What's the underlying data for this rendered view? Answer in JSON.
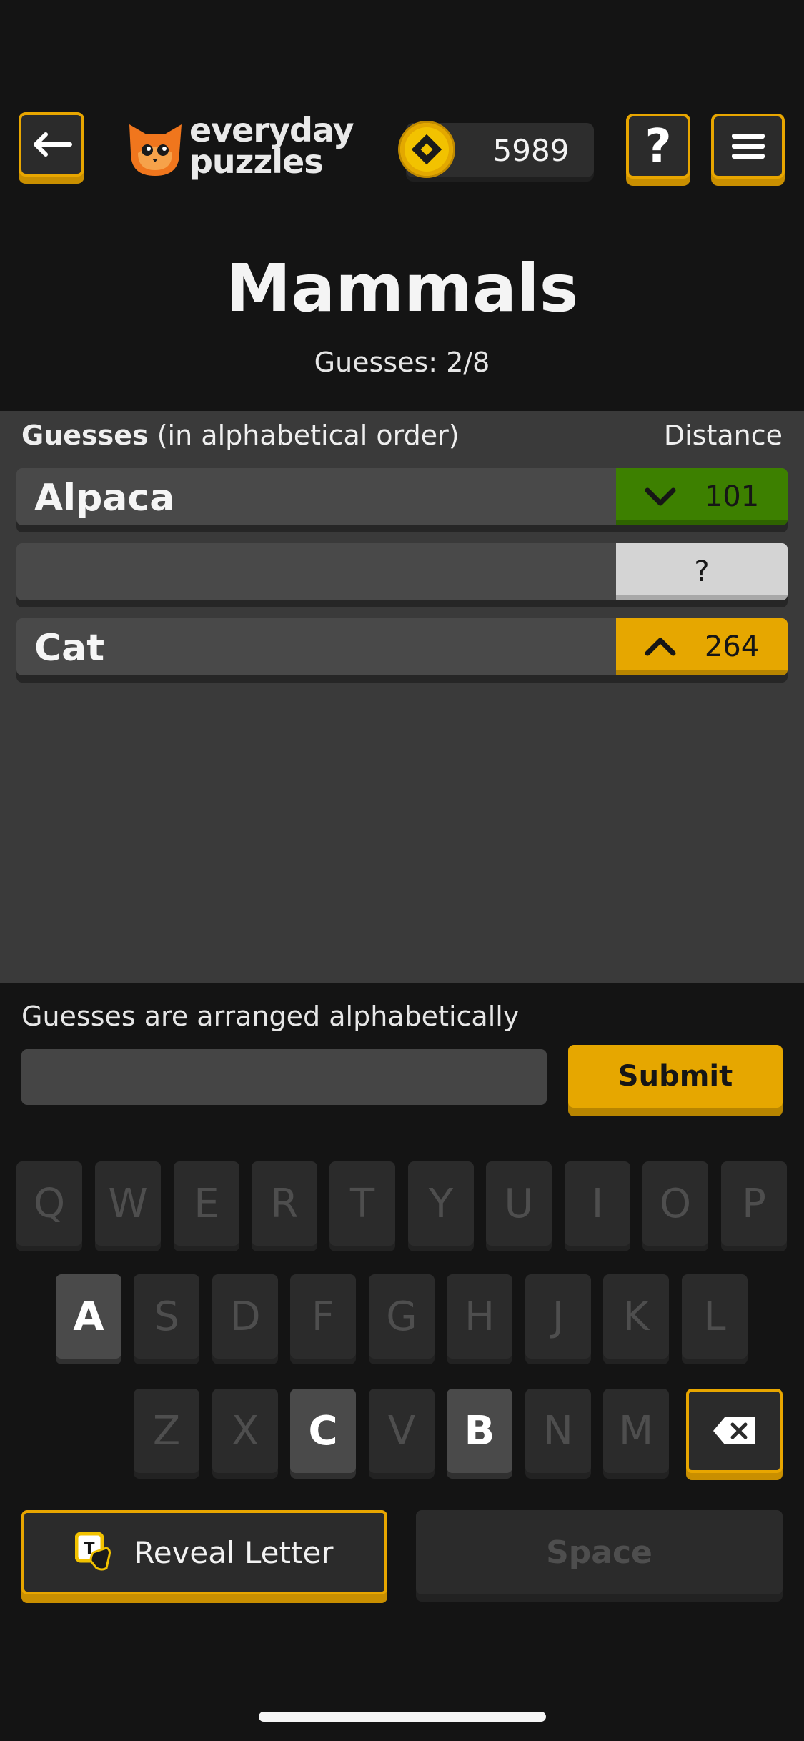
{
  "header": {
    "brand_line1": "everyday",
    "brand_line2": "puzzles",
    "coins": "5989",
    "help_label": "?"
  },
  "game": {
    "title": "Mammals",
    "guess_counter": "Guesses: 2/8"
  },
  "panel": {
    "header_left_bold": "Guesses",
    "header_left_rest": " (in alphabetical order)",
    "header_right": "Distance",
    "rows": [
      {
        "label": "Alpaca",
        "direction": "down",
        "distance": "101",
        "status": "green"
      },
      {
        "label": "",
        "direction": "",
        "distance": "?",
        "status": "unknown"
      },
      {
        "label": "Cat",
        "direction": "up",
        "distance": "264",
        "status": "yellow"
      }
    ]
  },
  "input": {
    "hint": "Guesses are arranged alphabetically",
    "value": "",
    "submit_label": "Submit"
  },
  "keyboard": {
    "row1": [
      "Q",
      "W",
      "E",
      "R",
      "T",
      "Y",
      "U",
      "I",
      "O",
      "P"
    ],
    "row2": [
      "A",
      "S",
      "D",
      "F",
      "G",
      "H",
      "J",
      "K",
      "L"
    ],
    "row3": [
      "Z",
      "X",
      "C",
      "V",
      "B",
      "N",
      "M"
    ],
    "active_keys": [
      "A",
      "C",
      "B"
    ],
    "reveal_label": "Reveal Letter",
    "space_label": "Space"
  },
  "colors": {
    "accent": "#e6a700",
    "correct_close": "#3d8000",
    "background": "#141414"
  }
}
